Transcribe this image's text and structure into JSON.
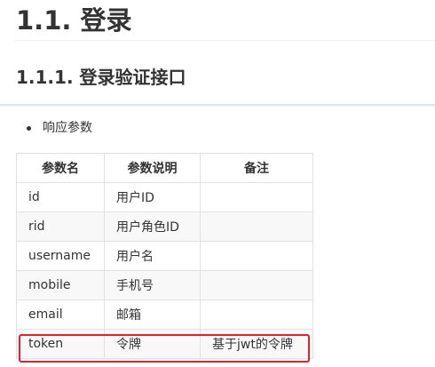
{
  "heading1": "1.1. 登录",
  "heading2": "1.1.1. 登录验证接口",
  "bullets": [
    "响应参数"
  ],
  "table": {
    "headers": [
      "参数名",
      "参数说明",
      "备注"
    ],
    "rows": [
      [
        "id",
        "用户ID",
        ""
      ],
      [
        "rid",
        "用户角色ID",
        ""
      ],
      [
        "username",
        "用户名",
        ""
      ],
      [
        "mobile",
        "手机号",
        ""
      ],
      [
        "email",
        "邮箱",
        ""
      ],
      [
        "token",
        "令牌",
        "基于jwt的令牌"
      ]
    ]
  },
  "highlight_color": "#e0202a"
}
